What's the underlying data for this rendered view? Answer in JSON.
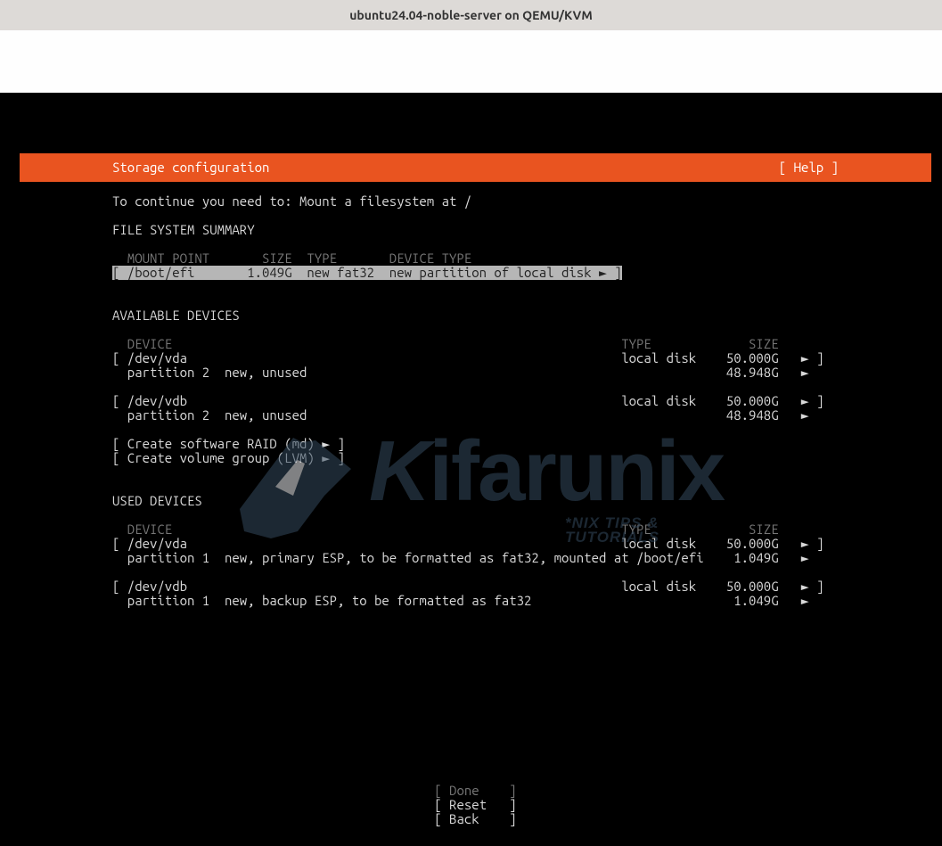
{
  "window_title": "ubuntu24.04-noble-server on QEMU/KVM",
  "header": {
    "title": "Storage configuration",
    "help": "[ Help ]"
  },
  "instruction": "To continue you need to: Mount a filesystem at /",
  "fs_summary": {
    "heading": "FILE SYSTEM SUMMARY",
    "cols": {
      "mount": "MOUNT POINT",
      "size": "SIZE",
      "type": "TYPE",
      "device_type": "DEVICE TYPE"
    },
    "row": {
      "mount": "/boot/efi",
      "size": "1.049G",
      "type": "new fat32",
      "device_type": "new partition of local disk",
      "arrow": "►"
    }
  },
  "available": {
    "heading": "AVAILABLE DEVICES",
    "cols": {
      "device": "DEVICE",
      "type": "TYPE",
      "size": "SIZE"
    },
    "devices": [
      {
        "name": "/dev/vda",
        "type": "local disk",
        "size": "50.000G",
        "arrow": "►",
        "partition": {
          "label": "partition 2",
          "desc": "new, unused",
          "size": "48.948G",
          "arrow": "►"
        }
      },
      {
        "name": "/dev/vdb",
        "type": "local disk",
        "size": "50.000G",
        "arrow": "►",
        "partition": {
          "label": "partition 2",
          "desc": "new, unused",
          "size": "48.948G",
          "arrow": "►"
        }
      }
    ],
    "actions": {
      "raid": "Create software RAID (md)",
      "lvm": "Create volume group (LVM)",
      "arrow": "►"
    }
  },
  "used": {
    "heading": "USED DEVICES",
    "cols": {
      "device": "DEVICE",
      "type": "TYPE",
      "size": "SIZE"
    },
    "devices": [
      {
        "name": "/dev/vda",
        "type": "local disk",
        "size": "50.000G",
        "arrow": "►",
        "partition": {
          "label": "partition 1",
          "desc": "new, primary ESP, to be formatted as fat32, mounted at /boot/efi",
          "size": "1.049G",
          "arrow": "►"
        }
      },
      {
        "name": "/dev/vdb",
        "type": "local disk",
        "size": "50.000G",
        "arrow": "►",
        "partition": {
          "label": "partition 1",
          "desc": "new, backup ESP, to be formatted as fat32",
          "size": "1.049G",
          "arrow": "►"
        }
      }
    ]
  },
  "buttons": {
    "done": "Done",
    "reset": "Reset",
    "back": "Back"
  },
  "watermark": {
    "brand": "Kifarunix",
    "tagline": "*NIX TIPS & TUTORIALS"
  }
}
